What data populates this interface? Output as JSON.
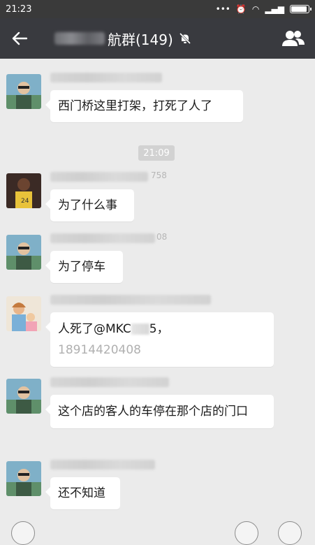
{
  "statusbar": {
    "time": "21:23"
  },
  "titlebar": {
    "back_icon": "back-arrow-icon",
    "title_visible": "航群(149)",
    "group_icon": "group-members-icon"
  },
  "timestamp": "21:09",
  "messages": [
    {
      "sender_suffix": "",
      "text": "西门桥这里打架，打死了人了"
    },
    {
      "sender_suffix": "758",
      "text": "为了什么事"
    },
    {
      "sender_suffix": "08",
      "text": "为了停车"
    },
    {
      "sender_suffix": "",
      "text_line1": "人死了@MKC",
      "text_line1_tail": "5，",
      "text_line2": "18914420408"
    },
    {
      "sender_suffix": "",
      "text": "这个店的客人的车停在那个店的门口"
    },
    {
      "sender_suffix": "",
      "text": "还不知道"
    }
  ]
}
